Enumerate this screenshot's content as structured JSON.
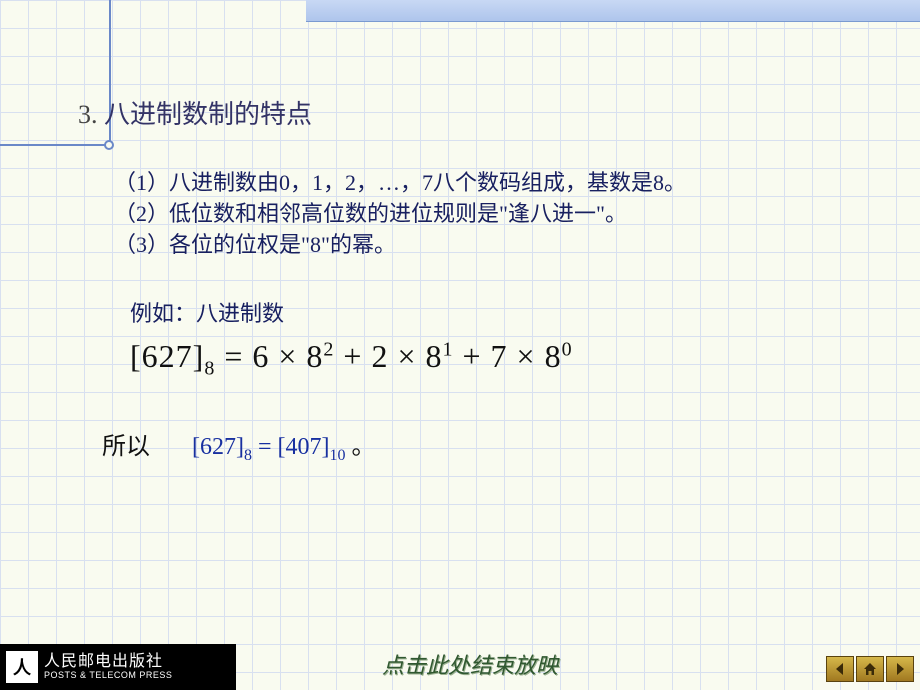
{
  "heading": {
    "number": "3.",
    "title": "八进制数制的特点"
  },
  "points": {
    "p1": "（1）八进制数由0，1，2，…，7八个数码组成，基数是8。",
    "p2": "（2）低位数和相邻高位数的进位规则是\"逢八进一\"。",
    "p3": "（3）各位的位权是\"8\"的幂。"
  },
  "example_label": "例如：八进制数",
  "formula": {
    "lhs_open": "[",
    "lhs_num": "627",
    "lhs_close": "]",
    "lhs_sub": "8",
    "eq": " = ",
    "t1_coef": "6",
    "t1_mul": " × ",
    "t1_base": "8",
    "t1_exp": "2",
    "plus1": " + ",
    "t2_coef": "2",
    "t2_mul": " × ",
    "t2_base": "8",
    "t2_exp": "1",
    "plus2": " + ",
    "t3_coef": "7",
    "t3_mul": " × ",
    "t3_base": "8",
    "t3_exp": "0"
  },
  "conclusion": {
    "label": "所以",
    "lhs": "[627]",
    "lhs_sub": "8",
    "eq": " = ",
    "rhs": "[407]",
    "rhs_sub": "10",
    "punct": "。"
  },
  "footer": {
    "zh": "人民邮电出版社",
    "en": "POSTS & TELECOM PRESS",
    "mark": "人"
  },
  "end_link": "点击此处结束放映",
  "nav": {
    "prev": "prev-slide",
    "home": "home",
    "next": "next-slide"
  }
}
